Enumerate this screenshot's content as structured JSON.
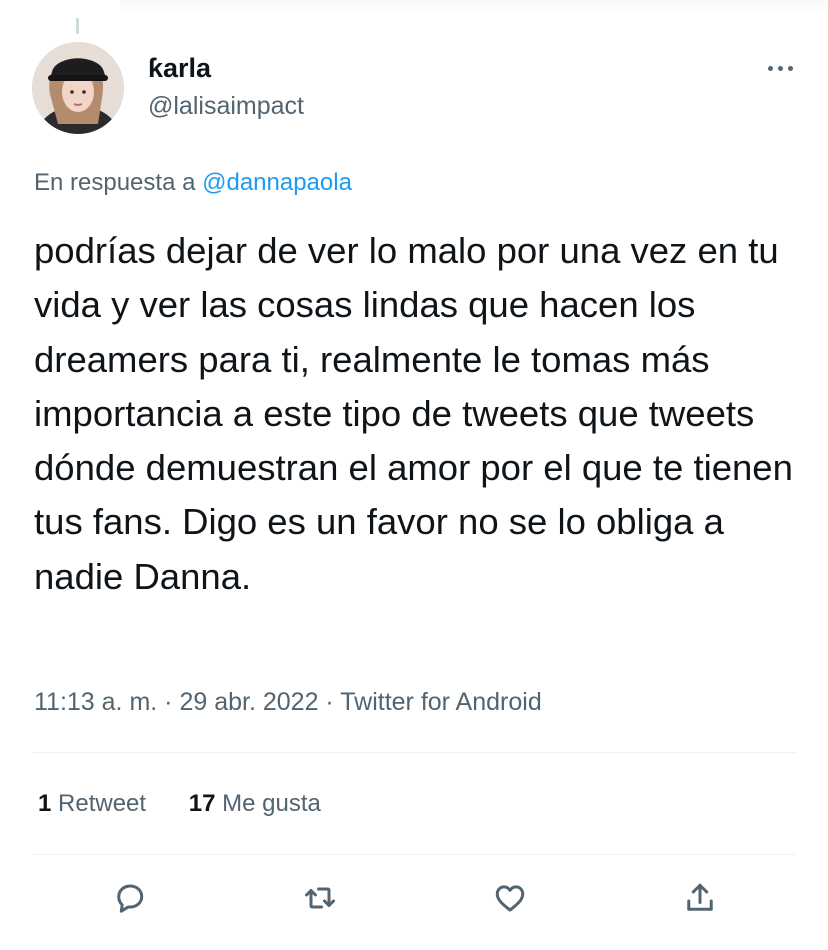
{
  "author": {
    "display_name": "ƙarla",
    "handle": "@lalisaimpact"
  },
  "reply_context": {
    "prefix": "En respuesta a",
    "mention": "@dannapaola"
  },
  "tweet": {
    "text": "podrías dejar de ver lo malo por una vez en tu vida y ver las cosas lindas que hacen los dreamers para ti, realmente le tomas más importancia a este tipo de tweets que tweets dónde demuestran el amor por el que te tienen tus fans. Digo es un favor no se lo obliga a nadie Danna."
  },
  "meta": {
    "time": "11:13 a. m.",
    "separator": "·",
    "date": "29 abr. 2022",
    "source": "Twitter for Android"
  },
  "stats": {
    "retweets_count": "1",
    "retweets_label": "Retweet",
    "likes_count": "17",
    "likes_label": "Me gusta"
  },
  "actions": [
    {
      "icon": "reply-icon"
    },
    {
      "icon": "retweet-icon"
    },
    {
      "icon": "like-icon"
    },
    {
      "icon": "share-icon"
    }
  ]
}
